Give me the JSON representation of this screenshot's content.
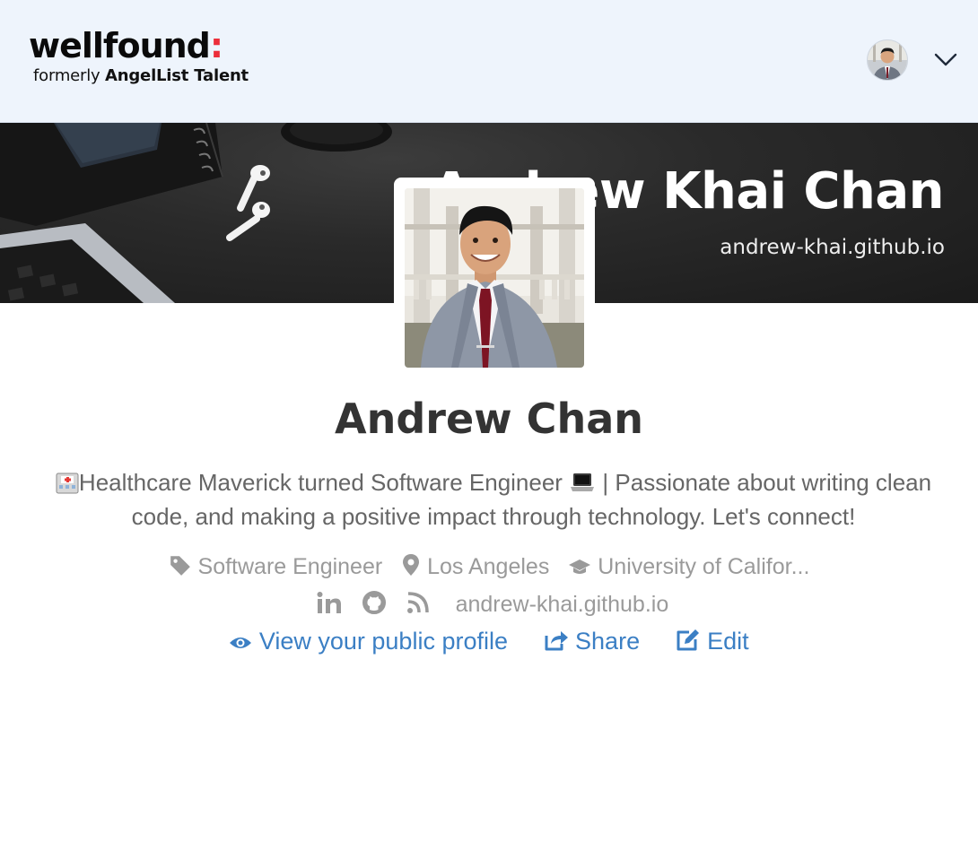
{
  "header": {
    "logo_word": "wellfound",
    "logo_colon": ":",
    "logo_sub_prefix": "formerly ",
    "logo_sub_brand": "AngelList Talent",
    "nav_avatar_icon": "user-avatar",
    "menu_icon": "chevron-down-icon"
  },
  "banner": {
    "name": "Andrew Khai Chan",
    "url": "andrew-khai.github.io"
  },
  "profile": {
    "name": "Andrew Chan",
    "bio_line1": "Healthcare Maverick turned Software Engineer",
    "bio_line1_suffix": " | Passionate about writing clean",
    "bio_line2": "code, and making a positive impact through technology. Let's connect!",
    "role": "Software Engineer",
    "location": "Los Angeles",
    "school": "University of Califor...",
    "website": "andrew-khai.github.io"
  },
  "actions": {
    "view_profile": "View your public profile",
    "share": "Share",
    "edit": "Edit"
  },
  "colors": {
    "header_bg": "#eef4fc",
    "link_blue": "#3b7fc4",
    "logo_accent": "#ec2e3a",
    "muted_text": "#9a9a9a"
  }
}
